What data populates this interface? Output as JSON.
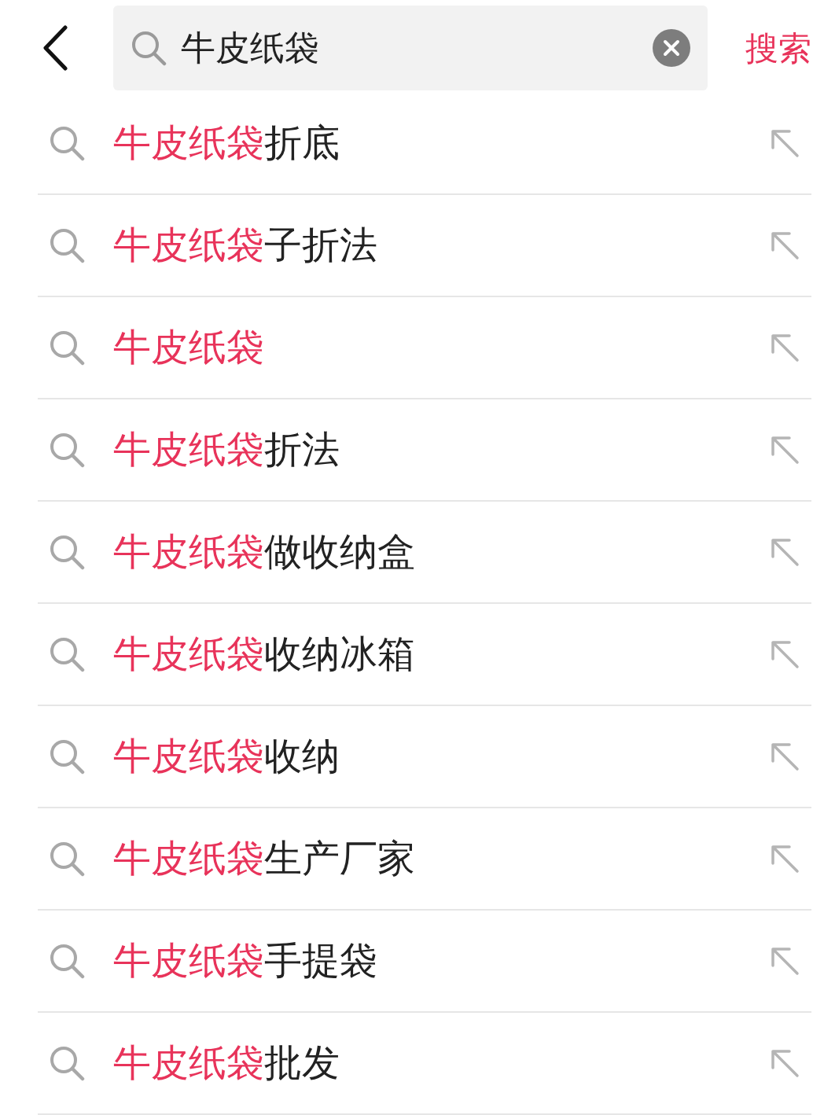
{
  "search": {
    "value": "牛皮纸袋",
    "submit": "搜索"
  },
  "suggestions": [
    {
      "match": "牛皮纸袋",
      "rest": "折底"
    },
    {
      "match": "牛皮纸袋",
      "rest": "子折法"
    },
    {
      "match": "牛皮纸袋"
    },
    {
      "match": "牛皮纸袋",
      "rest": "折法"
    },
    {
      "match": "牛皮纸袋",
      "rest": "做收纳盒"
    },
    {
      "match": "牛皮纸袋",
      "rest": "收纳冰箱"
    },
    {
      "match": "牛皮纸袋",
      "rest": "收纳"
    },
    {
      "match": "牛皮纸袋",
      "rest": "生产厂家"
    },
    {
      "match": "牛皮纸袋",
      "rest": "手提袋"
    },
    {
      "match": "牛皮纸袋",
      "rest": "批发"
    }
  ]
}
